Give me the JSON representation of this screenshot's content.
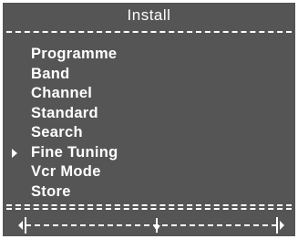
{
  "header": {
    "title": "Install"
  },
  "menu": {
    "items": [
      {
        "label": "Programme",
        "selected": false
      },
      {
        "label": "Band",
        "selected": false
      },
      {
        "label": "Channel",
        "selected": false
      },
      {
        "label": "Standard",
        "selected": false
      },
      {
        "label": "Search",
        "selected": false
      },
      {
        "label": "Fine Tuning",
        "selected": true
      },
      {
        "label": "Vcr Mode",
        "selected": false
      },
      {
        "label": "Store",
        "selected": false
      }
    ]
  },
  "fine_tuning_slider": {
    "value_fraction": 0.52,
    "left_arrow_icon": "triangle-left-icon",
    "right_arrow_icon": "triangle-right-icon"
  },
  "colors": {
    "background": "#555555",
    "foreground": "#ffffff"
  }
}
